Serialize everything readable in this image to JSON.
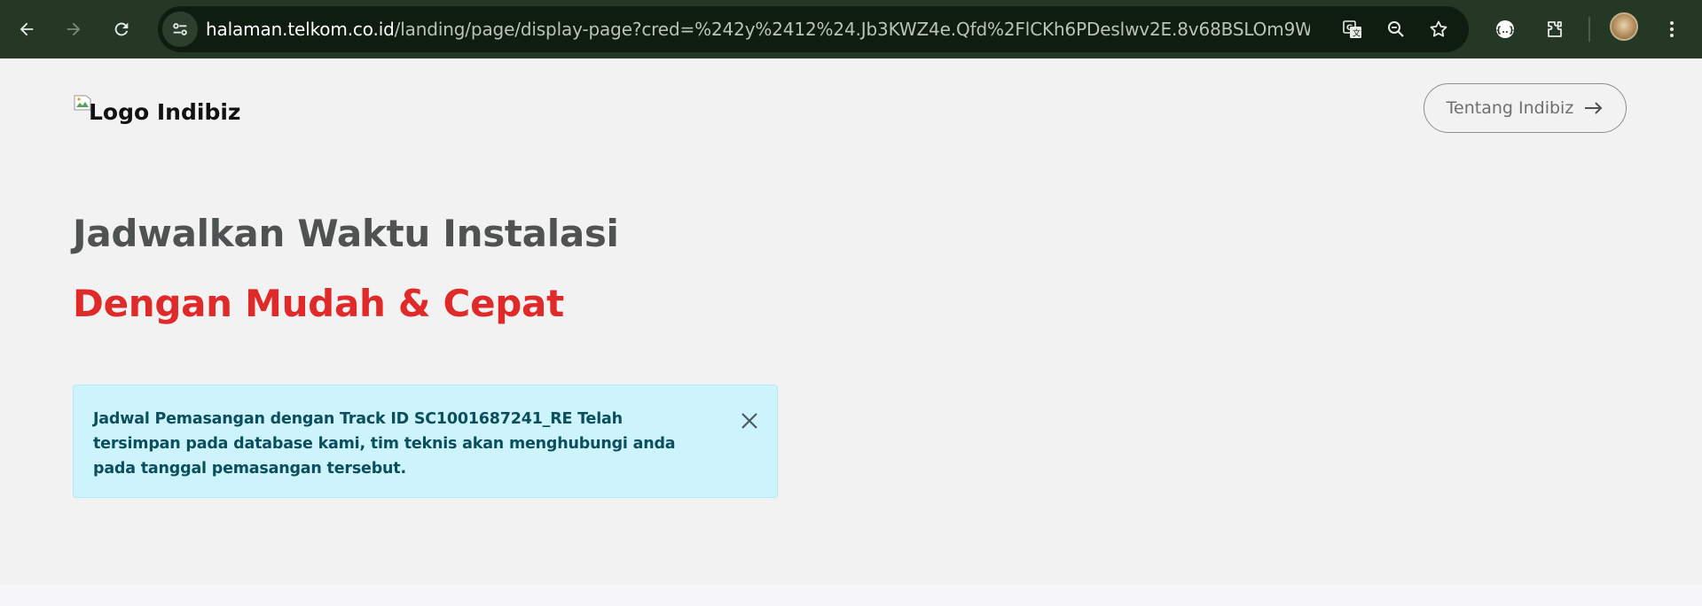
{
  "browser": {
    "url_host": "halaman.telkom.co.id",
    "url_path": "/landing/page/display-page?cred=%242y%2412%24.Jb3KWZ4e.Qfd%2FlCKh6PDeslwv2E.8v68BSLOm9WCGy9YX....",
    "icons": [
      "back-icon",
      "forward-icon",
      "reload-icon",
      "site-info-icon",
      "translate-icon",
      "zoom-icon",
      "bookmark-star-icon",
      "extension-icon",
      "puzzle-icon",
      "more-vert-icon"
    ]
  },
  "header": {
    "logo_alt": "Logo Indibiz",
    "about_button": "Tentang Indibiz"
  },
  "hero": {
    "title": "Jadwalkan Waktu Instalasi",
    "subtitle": "Dengan Mudah & Cepat"
  },
  "alert": {
    "message": "Jadwal Pemasangan dengan Track ID SC1001687241_RE Telah tersimpan pada database kami, tim teknis akan menghubungi anda pada tanggal pemasangan tersebut."
  },
  "colors": {
    "browser_toolbar": "#253725",
    "omnibox": "#0f1c10",
    "subtitle_red": "#e02a2a",
    "alert_bg": "#cdf4fc",
    "alert_text": "#0b4e5c"
  }
}
